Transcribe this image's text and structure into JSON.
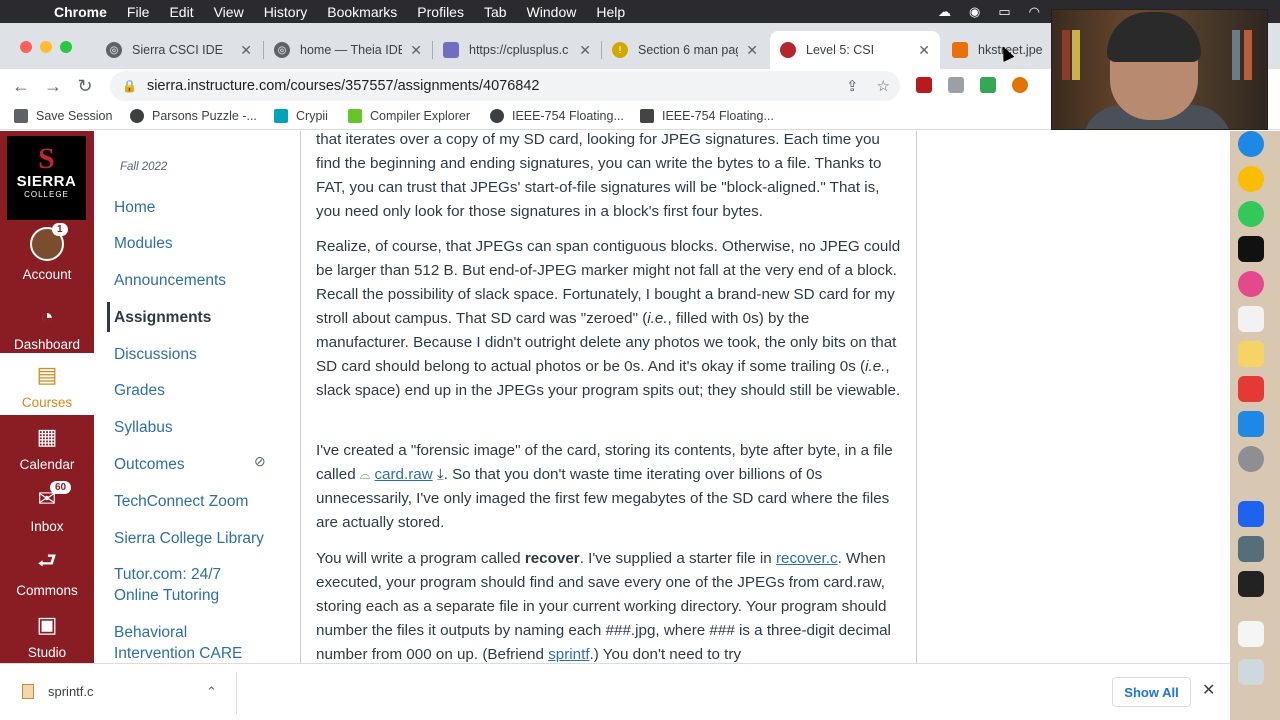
{
  "menubar": {
    "app": "Chrome",
    "items": [
      "File",
      "Edit",
      "View",
      "History",
      "Bookmarks",
      "Profiles",
      "Tab",
      "Window",
      "Help"
    ]
  },
  "tabs": [
    {
      "title": "Sierra CSCI IDE",
      "active": false
    },
    {
      "title": "home — Theia IDE",
      "active": false
    },
    {
      "title": "https://cplusplus.c",
      "active": false
    },
    {
      "title": "Section 6 man pag",
      "active": false
    },
    {
      "title": "Level 5: CSI",
      "active": true
    },
    {
      "title": "hkstreet.jpeg",
      "active": false
    }
  ],
  "omnibox": {
    "url": "sierra.instructure.com/courses/357557/assignments/4076842"
  },
  "bookmarks": [
    "Save Session",
    "Parsons Puzzle -...",
    "Crypii",
    "Compiler Explorer",
    "IEEE-754 Floating...",
    "IEEE-754 Floating..."
  ],
  "globalnav": {
    "logo": {
      "big": "S",
      "name": "SIERRA",
      "sub": "COLLEGE"
    },
    "items": [
      {
        "label": "Account",
        "badge": "1"
      },
      {
        "label": "Dashboard"
      },
      {
        "label": "Courses"
      },
      {
        "label": "Calendar"
      },
      {
        "label": "Inbox",
        "badge": "60"
      },
      {
        "label": "Commons"
      },
      {
        "label": "Studio"
      }
    ]
  },
  "coursenav": {
    "term": "Fall 2022",
    "items": [
      "Home",
      "Modules",
      "Announcements",
      "Assignments",
      "Discussions",
      "Grades",
      "Syllabus",
      "Outcomes",
      "TechConnect Zoom",
      "Sierra College Library",
      "Tutor.com: 24/7 Online Tutoring",
      "Behavioral Intervention CARE"
    ]
  },
  "content": {
    "p1": "that iterates over a copy of my SD card, looking for JPEG signatures. Each time you find the beginning and ending signatures, you can write the bytes to a file. Thanks to FAT, you can trust that JPEGs' start-of-file signatures will be \"block-aligned.\" That is, you need only look for those signatures in a block's first four bytes.",
    "p2a": "Realize, of course, that JPEGs can span contiguous blocks. Otherwise, no JPEG could be larger than 512 B. But end-of-JPEG marker might not fall at the very end of a block. Recall the possibility of slack space. Fortunately, I bought a brand-new SD card for my stroll about campus. That SD card was \"zeroed\" (",
    "p2ie1": "i.e.",
    "p2b": ", filled with 0s) by the manufacturer. Because I didn't outright delete any photos we took, the only bits on that SD card should belong to actual photos or be 0s. And it's okay if some trailing 0s (",
    "p2ie2": "i.e.",
    "p2c": ", slack space) end up in the JPEGs your program spits out; they should still be viewable.",
    "p3a": "I've created a \"forensic image\" of the card, storing its contents, byte after byte, in a file called",
    "p3link": "card.raw",
    "p3b": ". So that you don't waste time iterating over billions of 0s unnecessarily, I've only imaged the first few megabytes of the SD card where the files are actually stored.",
    "p4a": "You will write a program called",
    "p4bold": "recover",
    "p4b": ". I've supplied a starter file in",
    "p4link": "recover.c",
    "p4c": ". When executed, your program should find and save every one of the JPEGs from card.raw, storing each as a separate file in your current working directory. Your program should number the files it outputs by naming each ###.jpg, where ### is a three-digit decimal number from 000 on up. (Befriend",
    "p4link2": "sprintf",
    "p4d": ".) You don't need to try"
  },
  "downloads": {
    "file": "sprintf.c",
    "show_all": "Show All"
  },
  "colors": {
    "canvas_red": "#8a1d24",
    "link": "#2d6fa8",
    "courses_active": "#d9871b"
  }
}
